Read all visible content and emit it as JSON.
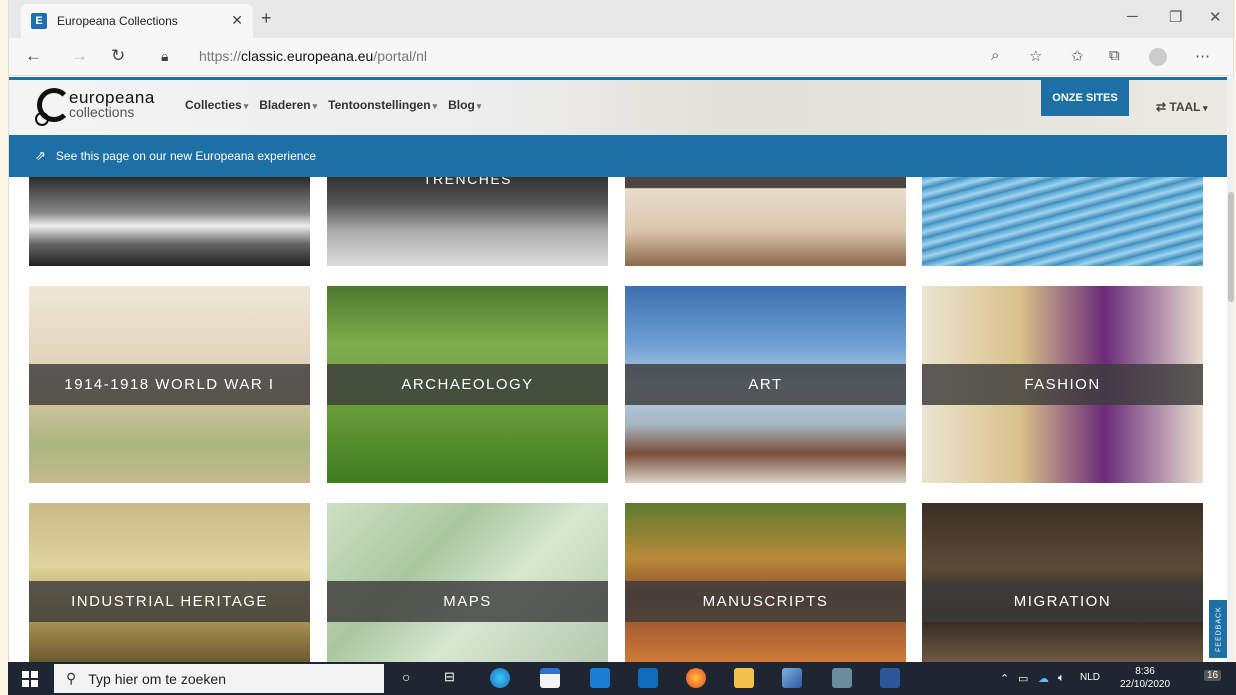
{
  "browser": {
    "tab_title": "Europeana Collections",
    "tab_favicon": "E",
    "url_protocol": "https://",
    "url_host": "classic.europeana.eu",
    "url_path": "/portal/nl"
  },
  "site": {
    "logo_line1": "europeana",
    "logo_line2": "collections",
    "nav": [
      "Collecties",
      "Bladeren",
      "Tentoonstellingen",
      "Blog"
    ],
    "onze_sites": "ONZE SITES",
    "taal": "TAAL",
    "banner_text": "See this page on our new Europeana experience",
    "partial_tile_label": "TRENCHES",
    "feedback": "FEEDBACK"
  },
  "tiles": [
    {
      "label": "1914-1918 WORLD WAR I"
    },
    {
      "label": "ARCHAEOLOGY"
    },
    {
      "label": "ART"
    },
    {
      "label": "FASHION"
    },
    {
      "label": "INDUSTRIAL HERITAGE"
    },
    {
      "label": "MAPS"
    },
    {
      "label": "MANUSCRIPTS"
    },
    {
      "label": "MIGRATION"
    }
  ],
  "taskbar": {
    "search_placeholder": "Typ hier om te zoeken",
    "lang": "NLD",
    "time": "8:36",
    "date": "22/10/2020",
    "notif_count": "16"
  },
  "colors": {
    "brand_blue": "#1d6fa4",
    "label_bg": "#3c3c3c"
  }
}
